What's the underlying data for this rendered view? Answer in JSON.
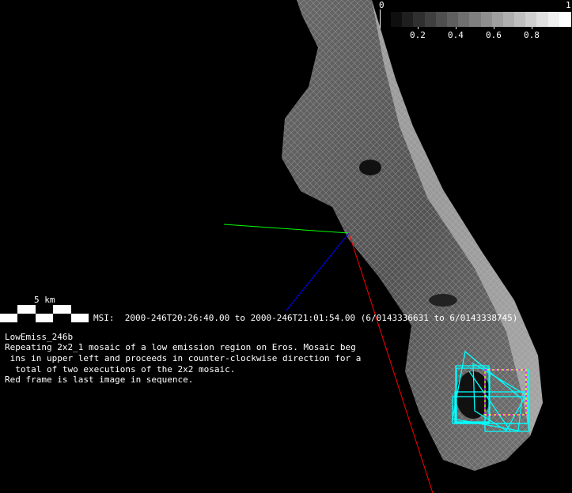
{
  "colorbar": {
    "min_label": "0",
    "max_label": "1",
    "tick_labels": [
      "0.2",
      "0.4",
      "0.6",
      "0.8"
    ],
    "steps": 16
  },
  "scale_bar": {
    "label": "5 km"
  },
  "observation": {
    "line": "MSI:  2000-246T20:26:40.00 to 2000-246T21:01:54.00 (6/0143336631 to 6/0143338745)"
  },
  "description": {
    "title": "LowEmiss_246b",
    "lines": [
      "Repeating 2x2_1 mosaic of a low emission region on Eros. Mosaic beg",
      " ins in upper left and proceeds in counter-clockwise direction for a",
      "  total of two executions of the 2x2 mosaic.",
      "Red frame is last image in sequence."
    ]
  },
  "colors": {
    "axis_x": "#ff0000",
    "axis_y": "#00ff00",
    "axis_z": "#0000ff",
    "footprint": "#00ffff",
    "last_frame_a": "#ff00ff",
    "last_frame_b": "#ffff00"
  }
}
